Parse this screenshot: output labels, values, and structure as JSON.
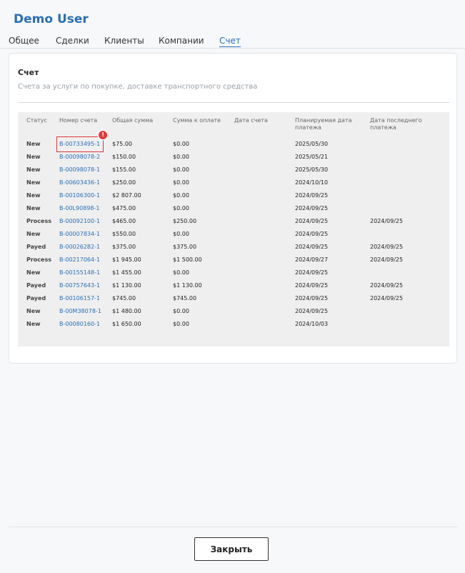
{
  "header": {
    "user_name": "Demo User"
  },
  "tabs": [
    {
      "label": "Общее",
      "active": false
    },
    {
      "label": "Сделки",
      "active": false
    },
    {
      "label": "Клиенты",
      "active": false
    },
    {
      "label": "Компании",
      "active": false
    },
    {
      "label": "Счет",
      "active": true
    }
  ],
  "card": {
    "title": "Счет",
    "subtitle": "Счета за услуги по покупке, доставке транспортного средства"
  },
  "table": {
    "columns": [
      "Статус",
      "Номер счета",
      "Общая сумма",
      "Сумма к оплате",
      "Дата счета",
      "Планируемая дата платежа",
      "Дата последнего платежа"
    ],
    "rows": [
      [
        "New",
        "B-00733495-1",
        "$75.00",
        "$0.00",
        "",
        "2025/05/30",
        ""
      ],
      [
        "New",
        "B-00098078-2",
        "$150.00",
        "$0.00",
        "",
        "2025/05/21",
        ""
      ],
      [
        "New",
        "B-00098078-1",
        "$155.00",
        "$0.00",
        "",
        "2025/05/30",
        ""
      ],
      [
        "New",
        "B-00603436-1",
        "$250.00",
        "$0.00",
        "",
        "2024/10/10",
        ""
      ],
      [
        "New",
        "B-00106300-1",
        "$2 807.00",
        "$0.00",
        "",
        "2024/09/25",
        ""
      ],
      [
        "New",
        "B-00L90898-1",
        "$475.00",
        "$0.00",
        "",
        "2024/09/25",
        ""
      ],
      [
        "Process",
        "B-00092100-1",
        "$465.00",
        "$250.00",
        "",
        "2024/09/25",
        "2024/09/25"
      ],
      [
        "New",
        "B-00007834-1",
        "$550.00",
        "$0.00",
        "",
        "2024/09/25",
        ""
      ],
      [
        "Payed",
        "B-00026282-1",
        "$375.00",
        "$375.00",
        "",
        "2024/09/25",
        "2024/09/25"
      ],
      [
        "Process",
        "B-00217064-1",
        "$1 945.00",
        "$1 500.00",
        "",
        "2024/09/27",
        "2024/09/25"
      ],
      [
        "New",
        "B-00155148-1",
        "$1 455.00",
        "$0.00",
        "",
        "2024/09/25",
        ""
      ],
      [
        "Payed",
        "B-00757643-1",
        "$1 130.00",
        "$1 130.00",
        "",
        "2024/09/25",
        "2024/09/25"
      ],
      [
        "Payed",
        "B-00106157-1",
        "$745.00",
        "$745.00",
        "",
        "2024/09/25",
        "2024/09/25"
      ],
      [
        "New",
        "B-00M38078-1",
        "$1 480.00",
        "$0.00",
        "",
        "2024/09/25",
        ""
      ],
      [
        "New",
        "B-00080160-1",
        "$1 650.00",
        "$0.00",
        "",
        "2024/10/03",
        ""
      ]
    ],
    "highlighted_row": 0,
    "highlight_badge": "!"
  },
  "footer": {
    "close_label": "Закрыть"
  },
  "colors": {
    "accent": "#2a6fb8",
    "highlight": "#d9373b",
    "badge": "#e53935"
  }
}
